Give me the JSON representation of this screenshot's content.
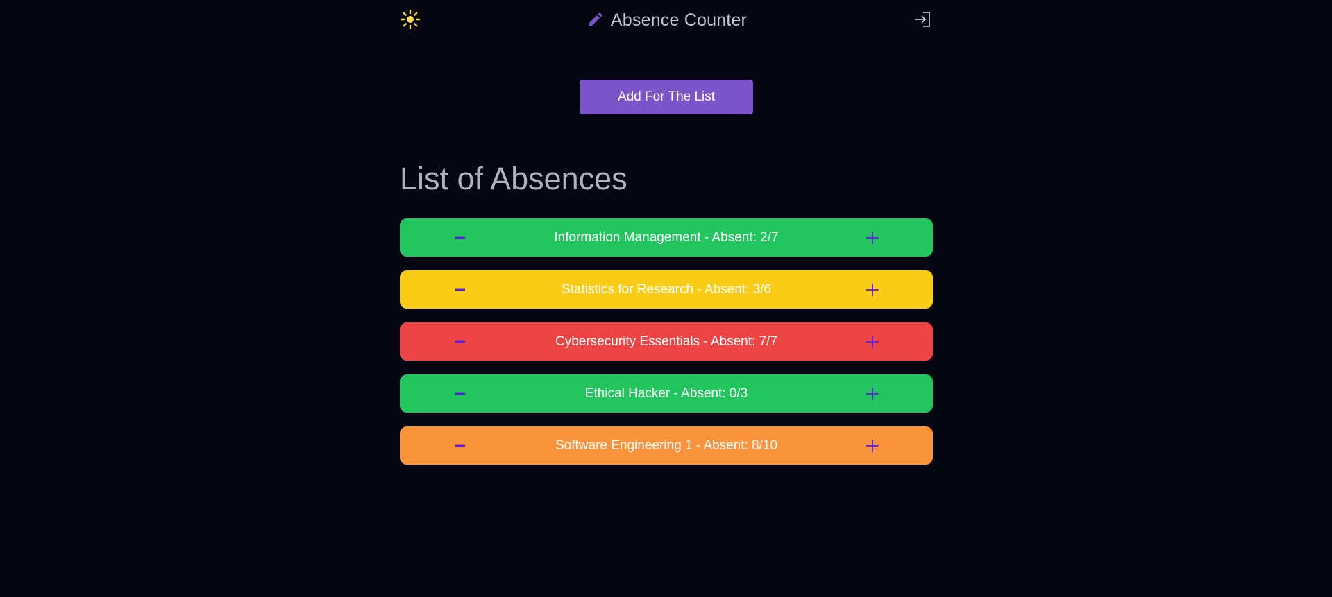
{
  "header": {
    "title": "Absence Counter",
    "theme_icon": "sun-icon",
    "brand_icon": "pencil-icon",
    "logout_icon": "sign-in-icon"
  },
  "add_button": {
    "label": "Add For The List"
  },
  "list": {
    "heading": "List of Absences",
    "items": [
      {
        "label": "Information Management - Absent: 2/7",
        "color": "#22c55e"
      },
      {
        "label": "Statistics for Research - Absent: 3/6",
        "color": "#facc15"
      },
      {
        "label": "Cybersecurity Essentials - Absent: 7/7",
        "color": "#ef4444"
      },
      {
        "label": "Ethical Hacker - Absent: 0/3",
        "color": "#22c55e"
      },
      {
        "label": "Software Engineering 1 - Absent: 8/10",
        "color": "#fb923c"
      }
    ]
  },
  "colors": {
    "background": "#070711",
    "accent": "#7a54c8",
    "control": "#5b1fe0",
    "sun": "#fde047"
  }
}
